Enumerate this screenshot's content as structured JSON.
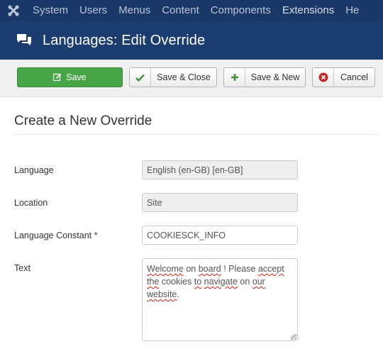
{
  "nav": {
    "items": [
      "System",
      "Users",
      "Menus",
      "Content",
      "Components",
      "Extensions",
      "He"
    ]
  },
  "header": {
    "title": "Languages: Edit Override",
    "icon": "comments-icon"
  },
  "toolbar": {
    "save_label": "Save",
    "save_close_label": "Save & Close",
    "save_new_label": "Save & New",
    "cancel_label": "Cancel"
  },
  "form": {
    "section_title": "Create a New Override",
    "language_label": "Language",
    "language_value": "English (en-GB) [en-GB]",
    "location_label": "Location",
    "location_value": "Site",
    "constant_label": "Language Constant *",
    "constant_value": "COOKIESCK_INFO",
    "text_label": "Text",
    "text_words": [
      "Welcome",
      " on ",
      "board",
      " ! Please ",
      "accept",
      " ",
      "the",
      " cookies ",
      "to",
      " ",
      "navigate",
      " on ",
      "our",
      " ",
      "website",
      "."
    ]
  },
  "colors": {
    "nav_bg": "#1a3867",
    "header_bg": "#1c3d70",
    "save_green": "#46a546",
    "cancel_red": "#c52827"
  }
}
